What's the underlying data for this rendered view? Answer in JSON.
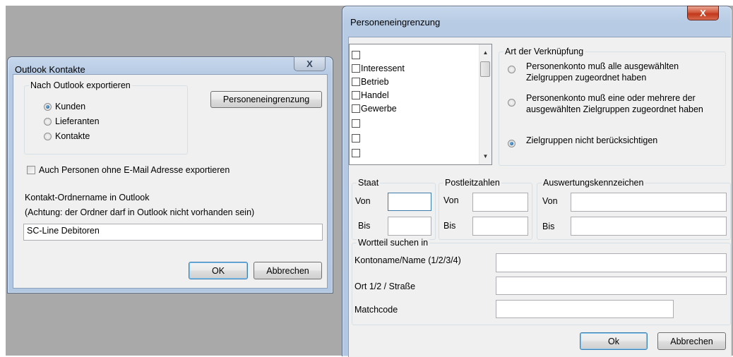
{
  "outlook_dialog": {
    "title": "Outlook Kontakte",
    "export_group_label": "Nach Outlook exportieren",
    "options": [
      "Kunden",
      "Lieferanten",
      "Kontakte"
    ],
    "selected_option": "Kunden",
    "filter_button": "Personeneingrenzung",
    "no_email_checkbox": "Auch Personen ohne E-Mail Adresse exportieren",
    "folder_label": "Kontakt-Ordnername in Outlook",
    "folder_note": "(Achtung: der Ordner darf in Outlook nicht vorhanden sein)",
    "folder_value": "SC-Line Debitoren",
    "ok": "OK",
    "cancel": "Abbrechen",
    "close_glyph": "X"
  },
  "filter_dialog": {
    "title": "Personeneingrenzung",
    "close_glyph": "X",
    "target_groups": [
      "",
      "Interessent",
      "Betrieb",
      "Handel",
      "Gewerbe",
      "",
      "",
      ""
    ],
    "link_group_label": "Art der Verknüpfung",
    "link_options": [
      "Personenkonto muß alle ausgewählten Zielgruppen zugeordnet haben",
      "Personenkonto muß eine oder mehrere der ausgewählten Zielgruppen zugeordnet haben",
      "Zielgruppen nicht berücksichtigen"
    ],
    "selected_link_option": 2,
    "staat_label": "Staat",
    "plz_label": "Postleitzahlen",
    "auswertung_label": "Auswertungskennzeichen",
    "von": "Von",
    "bis": "Bis",
    "wortteil_label": "Wortteil suchen in",
    "kontoname_label": "Kontoname/Name (1/2/3/4)",
    "ort_label": "Ort 1/2 / Straße",
    "matchcode_label": "Matchcode",
    "ok": "Ok",
    "cancel": "Abbrechen"
  }
}
